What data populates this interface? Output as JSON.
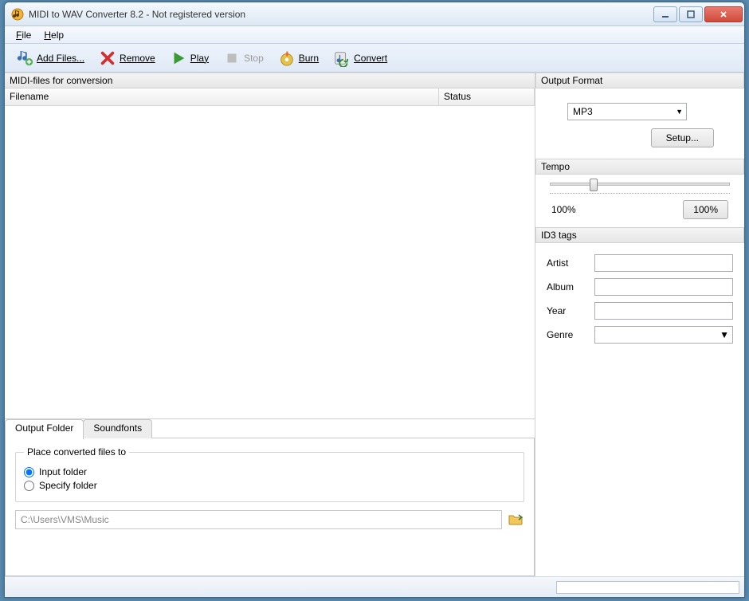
{
  "window": {
    "title": "MIDI to WAV Converter 8.2 - Not registered version"
  },
  "menu": {
    "file": "File",
    "help": "Help"
  },
  "toolbar": {
    "add_files": "Add Files...",
    "remove": "Remove",
    "play": "Play",
    "stop": "Stop",
    "burn": "Burn",
    "convert": "Convert"
  },
  "filelist": {
    "title": "MIDI-files for conversion",
    "col_filename": "Filename",
    "col_status": "Status"
  },
  "tabs": {
    "output_folder": "Output Folder",
    "soundfonts": "Soundfonts"
  },
  "output_folder": {
    "legend": "Place converted files to",
    "radio_input": "Input folder",
    "radio_specify": "Specify folder",
    "path": "C:\\Users\\VMS\\Music"
  },
  "output_format": {
    "header": "Output Format",
    "selected": "MP3",
    "setup_btn": "Setup..."
  },
  "tempo": {
    "header": "Tempo",
    "value_label": "100%",
    "display": "100%"
  },
  "id3": {
    "header": "ID3 tags",
    "artist_label": "Artist",
    "album_label": "Album",
    "year_label": "Year",
    "genre_label": "Genre",
    "artist": "",
    "album": "",
    "year": "",
    "genre": ""
  }
}
